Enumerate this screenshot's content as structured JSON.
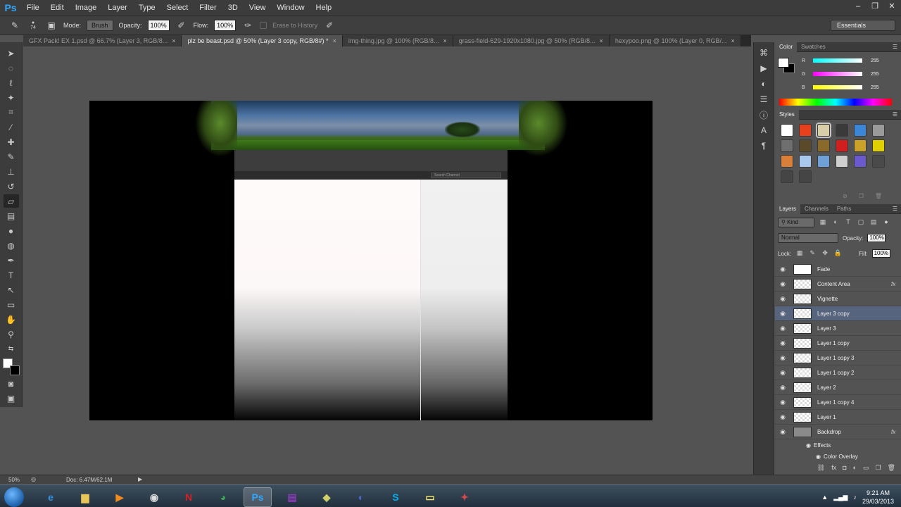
{
  "app": {
    "logo": "Ps"
  },
  "menu": [
    "File",
    "Edit",
    "Image",
    "Layer",
    "Type",
    "Select",
    "Filter",
    "3D",
    "View",
    "Window",
    "Help"
  ],
  "window_controls": [
    "minimize",
    "restore",
    "close"
  ],
  "options_bar": {
    "brush_size": "74",
    "mode_label": "Mode:",
    "mode_value": "Brush",
    "opacity_label": "Opacity:",
    "opacity_value": "100%",
    "flow_label": "Flow:",
    "flow_value": "100%",
    "erase_history": "Erase to History",
    "workspace": "Essentials"
  },
  "doc_tabs": [
    {
      "label": "GFX Pack! EX 1.psd @ 66.7% (Layer 3, RGB/8...",
      "active": false
    },
    {
      "label": "plz be beast.psd @ 50% (Layer 3 copy, RGB/8#) *",
      "active": true
    },
    {
      "label": "img-thing.jpg @ 100% (RGB/8...",
      "active": false
    },
    {
      "label": "grass-field-629-1920x1080.jpg @ 50% (RGB/8...",
      "active": false
    },
    {
      "label": "hexypoo.png @ 100% (Layer 0, RGB/...",
      "active": false
    }
  ],
  "canvas": {
    "search_placeholder": "Search Channel"
  },
  "status": {
    "zoom": "50%",
    "doc_info": "Doc: 6.47M/62.1M"
  },
  "color_panel": {
    "tabs": [
      "Color",
      "Swatches"
    ],
    "channels": [
      {
        "name": "R",
        "value": "255"
      },
      {
        "name": "G",
        "value": "255"
      },
      {
        "name": "B",
        "value": "255"
      }
    ]
  },
  "styles_panel": {
    "tab": "Styles",
    "swatch_colors": [
      "#ffffff",
      "#e8401c",
      "#d8cfa8",
      "#3a3a3a",
      "#3b86d6",
      "#9a9a9a",
      "#6f6f6f",
      "#5a4a2a",
      "#8a6a2a",
      "#d11f1f",
      "#caa22a",
      "#e0d000",
      "#d8803a",
      "#a8c8ee",
      "#6fa0d6",
      "#cfcfcf",
      "#6a5acd",
      "#4a4a4a",
      "#454545",
      "#454545"
    ]
  },
  "layers_panel": {
    "tabs": [
      "Layers",
      "Channels",
      "Paths"
    ],
    "kind": "Kind",
    "blend_mode": "Normal",
    "opacity_label": "Opacity:",
    "opacity_value": "100%",
    "lock_label": "Lock:",
    "fill_label": "Fill:",
    "fill_value": "100%",
    "layers": [
      {
        "name": "Fade",
        "thumb": "solid-white",
        "fx": "",
        "selected": false
      },
      {
        "name": "Content Area",
        "thumb": "checker",
        "fx": "fx",
        "selected": false
      },
      {
        "name": "Vignette",
        "thumb": "checker",
        "fx": "",
        "selected": false
      },
      {
        "name": "Layer 3 copy",
        "thumb": "checker",
        "fx": "",
        "selected": true
      },
      {
        "name": "Layer 3",
        "thumb": "checker",
        "fx": "",
        "selected": false
      },
      {
        "name": "Layer 1 copy",
        "thumb": "checker",
        "fx": "",
        "selected": false
      },
      {
        "name": "Layer 1 copy 3",
        "thumb": "checker",
        "fx": "",
        "selected": false
      },
      {
        "name": "Layer 1 copy 2",
        "thumb": "checker",
        "fx": "",
        "selected": false
      },
      {
        "name": "Layer 2",
        "thumb": "checker",
        "fx": "",
        "selected": false
      },
      {
        "name": "Layer 1 copy 4",
        "thumb": "checker",
        "fx": "",
        "selected": false
      },
      {
        "name": "Layer 1",
        "thumb": "checker",
        "fx": "",
        "selected": false
      },
      {
        "name": "Backdrop",
        "thumb": "grey",
        "fx": "fx",
        "selected": false
      }
    ],
    "effects_label": "Effects",
    "effect_item": "Color Overlay"
  },
  "taskbar": {
    "apps": [
      "internet-explorer",
      "file-explorer",
      "media-player",
      "camera-app",
      "netflix",
      "chrome",
      "photoshop",
      "winrar",
      "game-app",
      "cinema4d",
      "skype",
      "sticky-notes",
      "misc-app"
    ],
    "active_app": "photoshop",
    "time": "9:21 AM",
    "date": "29/03/2013"
  }
}
